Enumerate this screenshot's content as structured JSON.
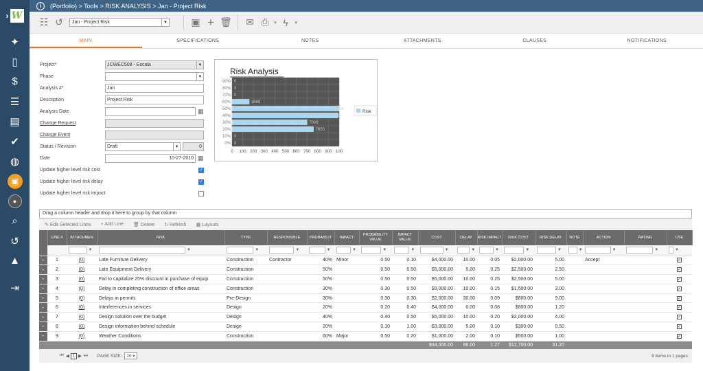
{
  "app": {
    "breadcrumb": "(Portfolio) > Tools > RISK ANALYSIS > Jan - Project Risk",
    "info_icon": "i"
  },
  "sidebar": {
    "logo": "W",
    "icons": [
      "lightbulb-icon",
      "document-icon",
      "dollar-icon",
      "bars-icon",
      "report-icon",
      "check-icon",
      "globe-icon",
      "briefcase-icon",
      "avatar",
      "search-icon",
      "history-icon",
      "graduation-icon",
      "logout-icon"
    ]
  },
  "toolbar": {
    "record_select": "Jan - Project Risk"
  },
  "tabs": [
    "MAIN",
    "SPECIFICATIONS",
    "NOTES",
    "ATTACHMENTS",
    "CLAUSES",
    "NOTIFICATIONS"
  ],
  "form": {
    "project_label": "Project*",
    "project_value": "JCWEC508 - Escala",
    "phase_label": "Phase",
    "phase_value": "",
    "analysis_label": "Analysis #*",
    "analysis_value": "Jan",
    "description_label": "Description",
    "description_value": "Project Risk",
    "analysis_date_label": "Analysis Date",
    "analysis_date_value": "",
    "change_request_label": "Change Request",
    "change_event_label": "Change Event",
    "status_label": "Status / Revision",
    "status_value": "Draft",
    "revision_value": "0",
    "date_label": "Date",
    "date_value": "10-27-2010",
    "update_cost_label": "Update higher level risk cost",
    "update_cost": true,
    "update_delay_label": "Update higher level risk delay",
    "update_delay": true,
    "update_impact_label": "Update higher level risk impact",
    "update_impact": false
  },
  "chart_data": {
    "type": "bar",
    "title": "Risk Analysis",
    "orientation": "horizontal",
    "categories": [
      "0%",
      "10%",
      "20%",
      "30%",
      "40%",
      "50%",
      "60%",
      "70%",
      "80%",
      "90%"
    ],
    "values": [
      0,
      0,
      7600,
      7000,
      9900,
      10000,
      1600,
      0,
      0,
      0
    ],
    "data_labels": [
      "0",
      "0",
      "7600",
      "7000",
      "9900",
      "10000",
      "1600",
      "0",
      "0",
      "0"
    ],
    "x_ticks": [
      "0",
      "100",
      "200",
      "300",
      "400",
      "500",
      "600",
      "700",
      "800",
      "900",
      "100"
    ],
    "xlim": [
      0,
      10000
    ],
    "legend": [
      {
        "name": "Risk",
        "color": "#a9d8f5"
      }
    ],
    "legend_position": "right",
    "bar_color": "#a9d8f5",
    "plot_background": "#555555",
    "grid": true
  },
  "grid": {
    "group_hint": "Drag a column header and drop it here to group by that column",
    "tools": {
      "edit": "Edit Selected Lines",
      "add": "Add Line",
      "delete": "Delete",
      "refresh": "Refresh",
      "layouts": "Layouts"
    },
    "columns": [
      "LINE #",
      "ATTACHMEN",
      "RISK",
      "TYPE",
      "RESPONSIBLE",
      "PROBABILIT",
      "IMPACT",
      "PROBABILITY VALUE",
      "IMPACT VALUE",
      "COST",
      "DELAY",
      "RISK IMPACT",
      "RISK COST",
      "RISK DELAY",
      "NOTE",
      "ACTION",
      "RATING",
      "USE"
    ],
    "rows": [
      {
        "line": "1",
        "att": "(0)",
        "risk": "Late Furniture Delivery",
        "type": "Construction",
        "resp": "Contractor",
        "prob": "40%",
        "impact": "Minor",
        "pv": "0.50",
        "iv": "0.10",
        "cost": "$4,000.00",
        "delay": "10.00",
        "ri": "0.05",
        "rc": "$2,000.00",
        "rd": "5.00",
        "note": "",
        "action": "Accept",
        "rating": "",
        "use": true
      },
      {
        "line": "2",
        "att": "(0)",
        "risk": "Late Equipment Delivery",
        "type": "Construction",
        "resp": "",
        "prob": "50%",
        "impact": "",
        "pv": "0.50",
        "iv": "0.50",
        "cost": "$5,000.00",
        "delay": "5.00",
        "ri": "0.25",
        "rc": "$2,500.00",
        "rd": "2.50",
        "note": "",
        "action": "",
        "rating": "",
        "use": true
      },
      {
        "line": "3",
        "att": "(0)",
        "risk": "Fail to capitalize 25% discount in purchase of equip",
        "type": "Construction",
        "resp": "",
        "prob": "50%",
        "impact": "",
        "pv": "0.50",
        "iv": "0.50",
        "cost": "$5,000.00",
        "delay": "10.00",
        "ri": "0.25",
        "rc": "$2,500.00",
        "rd": "5.00",
        "note": "",
        "action": "",
        "rating": "",
        "use": true
      },
      {
        "line": "4",
        "att": "(0)",
        "risk": "Delay in completing construction of office areas",
        "type": "Construction",
        "resp": "",
        "prob": "30%",
        "impact": "",
        "pv": "0.30",
        "iv": "0.50",
        "cost": "$5,000.00",
        "delay": "10.00",
        "ri": "0.15",
        "rc": "$1,500.00",
        "rd": "3.00",
        "note": "",
        "action": "",
        "rating": "",
        "use": true
      },
      {
        "line": "5",
        "att": "(0)",
        "risk": "Delays in permits",
        "type": "Pre-Design",
        "resp": "",
        "prob": "30%",
        "impact": "",
        "pv": "0.30",
        "iv": "0.30",
        "cost": "$2,000.00",
        "delay": "30.00",
        "ri": "0.09",
        "rc": "$600.00",
        "rd": "9.00",
        "note": "",
        "action": "",
        "rating": "",
        "use": true
      },
      {
        "line": "6",
        "att": "(0)",
        "risk": "Interferences in services",
        "type": "Design",
        "resp": "",
        "prob": "20%",
        "impact": "",
        "pv": "0.20",
        "iv": "0.40",
        "cost": "$4,000.00",
        "delay": "6.00",
        "ri": "0.08",
        "rc": "$800.00",
        "rd": "1.20",
        "note": "",
        "action": "",
        "rating": "",
        "use": true
      },
      {
        "line": "7",
        "att": "(0)",
        "risk": "Design solution over the budget",
        "type": "Design",
        "resp": "",
        "prob": "40%",
        "impact": "",
        "pv": "0.40",
        "iv": "0.50",
        "cost": "$5,000.00",
        "delay": "10.00",
        "ri": "0.20",
        "rc": "$2,000.00",
        "rd": "4.00",
        "note": "",
        "action": "",
        "rating": "",
        "use": true
      },
      {
        "line": "8",
        "att": "(0)",
        "risk": "Design information behind schedule",
        "type": "Design",
        "resp": "",
        "prob": "20%",
        "impact": "",
        "pv": "0.10",
        "iv": "1.00",
        "cost": "$3,000.00",
        "delay": "5.00",
        "ri": "0.10",
        "rc": "$300.00",
        "rd": "0.50",
        "note": "",
        "action": "",
        "rating": "",
        "use": true
      },
      {
        "line": "9",
        "att": "(0)",
        "risk": "Weather Conditions",
        "type": "Construction",
        "resp": "",
        "prob": "60%",
        "impact": "Major",
        "pv": "0.50",
        "iv": "0.20",
        "cost": "$1,000.00",
        "delay": "2.00",
        "ri": "0.10",
        "rc": "$500.00",
        "rd": "1.00",
        "note": "",
        "action": "",
        "rating": "",
        "use": true
      }
    ],
    "totals": {
      "cost": "$34,000.00",
      "delay": "88.00",
      "ri": "1.27",
      "rc": "$12,700.00",
      "rd": "31.20"
    },
    "pager": {
      "page": "1",
      "page_size_label": "PAGE SIZE:",
      "page_size": "20",
      "summary": "9 items in 1 pages"
    }
  }
}
